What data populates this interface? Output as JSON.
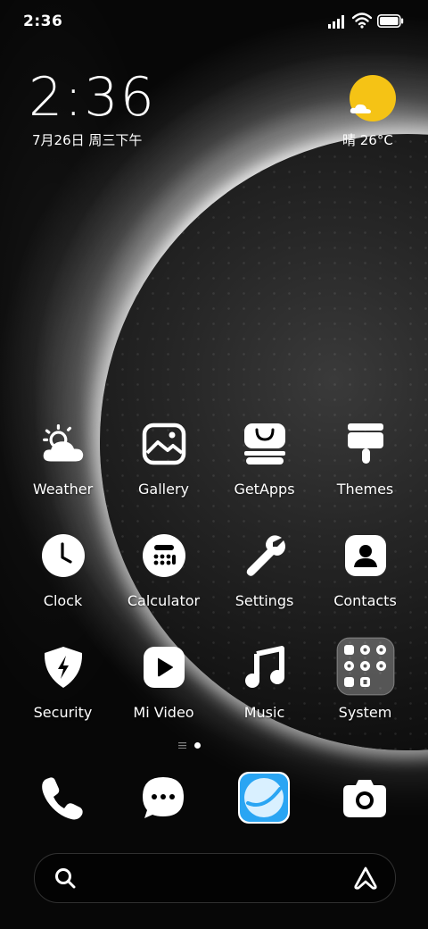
{
  "status": {
    "time": "2:36"
  },
  "clock_widget": {
    "time": "2:36",
    "date": "7月26日 周三下午"
  },
  "weather_widget": {
    "text": "晴 26°C",
    "icon": "sun-cloud-icon",
    "sun_color": "#f5c315"
  },
  "apps": [
    {
      "label": "Weather",
      "icon": "weather-icon"
    },
    {
      "label": "Gallery",
      "icon": "gallery-icon"
    },
    {
      "label": "GetApps",
      "icon": "getapps-icon"
    },
    {
      "label": "Themes",
      "icon": "themes-icon"
    },
    {
      "label": "Clock",
      "icon": "clock-icon"
    },
    {
      "label": "Calculator",
      "icon": "calculator-icon"
    },
    {
      "label": "Settings",
      "icon": "settings-icon"
    },
    {
      "label": "Contacts",
      "icon": "contacts-icon"
    },
    {
      "label": "Security",
      "icon": "security-icon"
    },
    {
      "label": "Mi Video",
      "icon": "mi-video-icon"
    },
    {
      "label": "Music",
      "icon": "music-icon"
    },
    {
      "label": "System",
      "icon": "system-folder-icon"
    }
  ],
  "dock": [
    {
      "icon": "phone-icon"
    },
    {
      "icon": "messages-icon"
    },
    {
      "icon": "browser-icon",
      "color": "#2aa5f3"
    },
    {
      "icon": "camera-icon"
    }
  ],
  "page_indicator": {
    "pages": 2,
    "current": 2
  },
  "search": {
    "icon": "search-icon",
    "assistant_icon": "assistant-icon"
  }
}
